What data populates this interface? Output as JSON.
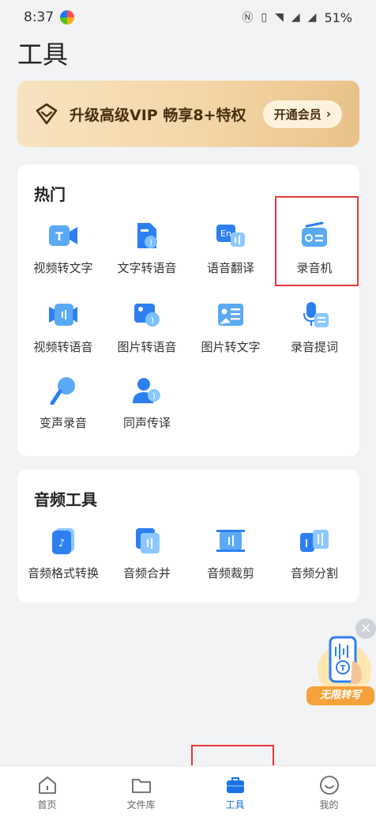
{
  "status": {
    "time": "8:37",
    "battery": "51%"
  },
  "page_title": "工具",
  "vip": {
    "text": "升级高级VIP 畅享8+特权",
    "button": "开通会员"
  },
  "hot": {
    "title": "热门",
    "tools": [
      {
        "label": "视频转文字",
        "icon": "video-text-icon"
      },
      {
        "label": "文字转语音",
        "icon": "text-speech-icon"
      },
      {
        "label": "语音翻译",
        "icon": "voice-translate-icon"
      },
      {
        "label": "录音机",
        "icon": "recorder-icon"
      },
      {
        "label": "视频转语音",
        "icon": "video-speech-icon"
      },
      {
        "label": "图片转语音",
        "icon": "image-speech-icon"
      },
      {
        "label": "图片转文字",
        "icon": "image-text-icon"
      },
      {
        "label": "录音提词",
        "icon": "teleprompter-icon"
      },
      {
        "label": "变声录音",
        "icon": "voice-changer-icon"
      },
      {
        "label": "同声传译",
        "icon": "interpret-icon"
      }
    ]
  },
  "audio": {
    "title": "音频工具",
    "tools": [
      {
        "label": "音频格式转换",
        "icon": "audio-format-icon"
      },
      {
        "label": "音频合并",
        "icon": "audio-merge-icon"
      },
      {
        "label": "音频裁剪",
        "icon": "audio-cut-icon"
      },
      {
        "label": "音频分割",
        "icon": "audio-split-icon"
      }
    ]
  },
  "promo": {
    "badge": "无限转写"
  },
  "nav": [
    {
      "label": "首页",
      "icon": "home-icon"
    },
    {
      "label": "文件库",
      "icon": "folder-icon"
    },
    {
      "label": "工具",
      "icon": "toolbox-icon",
      "active": true
    },
    {
      "label": "我的",
      "icon": "profile-icon"
    }
  ],
  "colors": {
    "accent": "#1a73e8",
    "vip_text": "#4a2e0e",
    "highlight": "#e53935"
  }
}
